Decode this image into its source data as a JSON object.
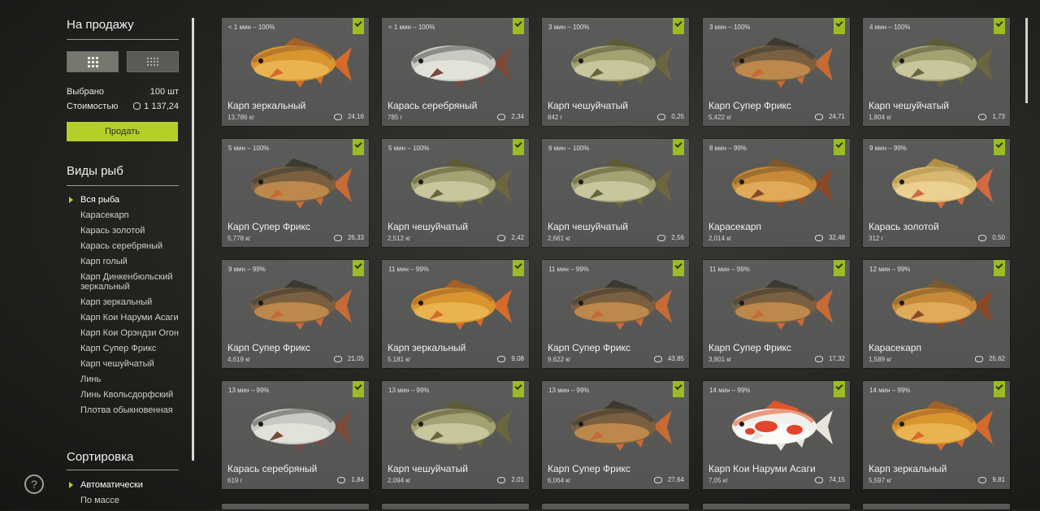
{
  "sidebar": {
    "sale_title": "На продажу",
    "selected_label": "Выбрано",
    "selected_value": "100 шт",
    "cost_label": "Стоимостью",
    "cost_value": "1 137,24",
    "sell_button": "Продать",
    "species_title": "Виды рыб",
    "species": [
      "Вся рыба",
      "Карасекарп",
      "Карась золотой",
      "Карась серебряный",
      "Карп голый",
      "Карп Динкенбюльский зеркальный",
      "Карп зеркальный",
      "Карп Кои Наруми Асаги",
      "Карп Кои Орэндзи Огон",
      "Карп Супер Фрикс",
      "Карп чешуйчатый",
      "Линь",
      "Линь Кволь­сдорфский",
      "Плотва обыкновенная"
    ],
    "sort_title": "Сортировка",
    "sort_options": [
      "Автоматически",
      "По массе"
    ],
    "help_glyph": "?"
  },
  "cards": [
    {
      "time": "< 1 мин – 100%",
      "name": "Карп зеркальный",
      "weight": "13,786 кг",
      "price": "24,16",
      "fish": "mirror"
    },
    {
      "time": "< 1 мин – 100%",
      "name": "Карась серебряный",
      "weight": "785 г",
      "price": "2,34",
      "fish": "silver"
    },
    {
      "time": "3 мин – 100%",
      "name": "Карп чешуйчатый",
      "weight": "842 г",
      "price": "0,25",
      "fish": "common"
    },
    {
      "time": "3 мин – 100%",
      "name": "Карп Супер Фрикс",
      "weight": "5,422 кг",
      "price": "24,71",
      "fish": "frix"
    },
    {
      "time": "4 мин – 100%",
      "name": "Карп чешуйчатый",
      "weight": "1,804 кг",
      "price": "1,73",
      "fish": "common"
    },
    {
      "time": "5 мин – 100%",
      "name": "Карп Супер Фрикс",
      "weight": "5,778 кг",
      "price": "26,33",
      "fish": "frix"
    },
    {
      "time": "5 мин – 100%",
      "name": "Карп чешуйчатый",
      "weight": "2,512 кг",
      "price": "2,42",
      "fish": "common"
    },
    {
      "time": "6 мин – 100%",
      "name": "Карп чешуйчатый",
      "weight": "2,661 кг",
      "price": "2,56",
      "fish": "common"
    },
    {
      "time": "8 мин – 99%",
      "name": "Карасекарп",
      "weight": "2,014 кг",
      "price": "32,48",
      "fish": "hybrid"
    },
    {
      "time": "9 мин – 99%",
      "name": "Карась золотой",
      "weight": "312 г",
      "price": "0,50",
      "fish": "golden"
    },
    {
      "time": "9 мин – 99%",
      "name": "Карп Супер Фрикс",
      "weight": "4,619 кг",
      "price": "21,05",
      "fish": "frix"
    },
    {
      "time": "11 мин – 99%",
      "name": "Карп зеркальный",
      "weight": "5,181 кг",
      "price": "9,08",
      "fish": "mirror"
    },
    {
      "time": "11 мин – 99%",
      "name": "Карп Супер Фрикс",
      "weight": "9,622 кг",
      "price": "43,85",
      "fish": "frix"
    },
    {
      "time": "11 мин – 99%",
      "name": "Карп Супер Фрикс",
      "weight": "3,801 кг",
      "price": "17,32",
      "fish": "frix"
    },
    {
      "time": "12 мин – 99%",
      "name": "Карасекарп",
      "weight": "1,589 кг",
      "price": "25,62",
      "fish": "hybrid"
    },
    {
      "time": "13 мин – 99%",
      "name": "Карась серебряный",
      "weight": "619 г",
      "price": "1,84",
      "fish": "silver"
    },
    {
      "time": "13 мин – 99%",
      "name": "Карп чешуйчатый",
      "weight": "2,094 кг",
      "price": "2,01",
      "fish": "common"
    },
    {
      "time": "13 мин – 99%",
      "name": "Карп Супер Фрикс",
      "weight": "6,064 кг",
      "price": "27,64",
      "fish": "frix"
    },
    {
      "time": "14 мин – 99%",
      "name": "Карп Кои Наруми Асаги",
      "weight": "7,05 кг",
      "price": "74,15",
      "fish": "koi"
    },
    {
      "time": "14 мин – 99%",
      "name": "Карп зеркальный",
      "weight": "5,597 кг",
      "price": "9,81",
      "fish": "mirror"
    }
  ],
  "colors": {
    "accent": "#b5cf2a",
    "check": "#9bbd23",
    "card_bg": "#575756"
  },
  "icons": {
    "view_large": "grid-large-icon",
    "view_small": "grid-small-icon",
    "coin": "coin-icon",
    "check": "check-icon",
    "help": "help-icon"
  }
}
